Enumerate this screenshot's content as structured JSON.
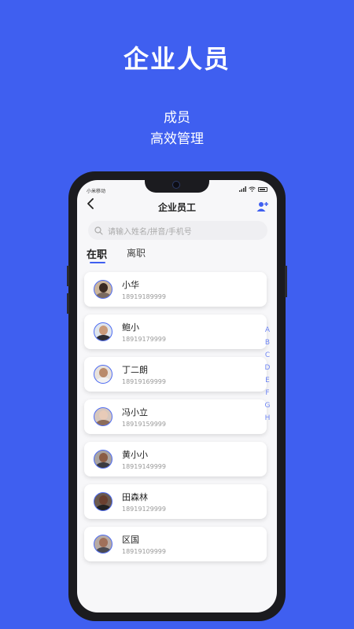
{
  "promo": {
    "title": "企业人员",
    "subtitle_line1": "成员",
    "subtitle_line2": "高效管理"
  },
  "status_bar": {
    "carrier": "小米移动"
  },
  "nav": {
    "title": "企业员工",
    "back_icon": "chevron-left-icon",
    "add_icon": "add-user-icon"
  },
  "search": {
    "placeholder": "请输入姓名/拼音/手机号"
  },
  "tabs": [
    {
      "label": "在职",
      "active": true
    },
    {
      "label": "离职",
      "active": false
    }
  ],
  "employees": [
    {
      "name": "小华",
      "phone": "18919189999"
    },
    {
      "name": "鲍小",
      "phone": "18919179999"
    },
    {
      "name": "丁二朗",
      "phone": "18919169999"
    },
    {
      "name": "冯小立",
      "phone": "18919159999"
    },
    {
      "name": "黄小小",
      "phone": "18919149999"
    },
    {
      "name": "田森林",
      "phone": "18919129999"
    },
    {
      "name": "区国",
      "phone": "18919109999"
    }
  ],
  "index_letters": [
    "A",
    "B",
    "C",
    "D",
    "E",
    "F",
    "G",
    "H"
  ],
  "colors": {
    "brand": "#3f5ff0",
    "index": "#6f86f3"
  }
}
